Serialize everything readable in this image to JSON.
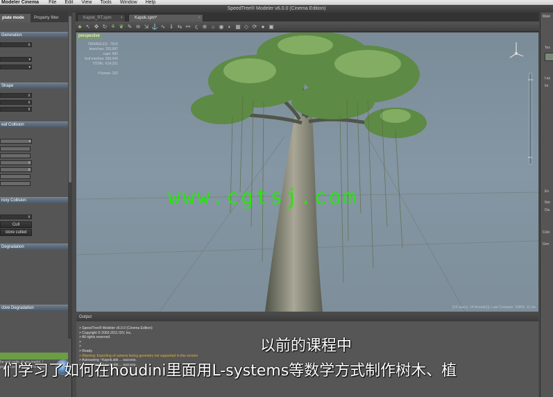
{
  "menubar": {
    "app": "Modeler Cinema",
    "items": [
      "File",
      "Edit",
      "View",
      "Tools",
      "Window",
      "Help"
    ]
  },
  "window": {
    "title": "SpeedTree® Modeler v6.0.0 (Cinema Edition)"
  },
  "left_panel": {
    "tabs": [
      "plate mode",
      "Property filter"
    ],
    "sections": [
      "Generation",
      "Shape",
      "eaf Collision",
      "roxy Collision",
      "Degradation",
      "ctive Degradation"
    ],
    "cull_button": "Cull",
    "restore_button": "store culled",
    "description": "he root node of any model. l parameters such as the t and",
    "colors": {
      "section": "#5c6a79",
      "selected": "#6a9d45"
    }
  },
  "doc_tabs": [
    {
      "label": "Kapok_RT.spm"
    },
    {
      "label": "Kapok.spm*"
    }
  ],
  "viewport": {
    "view_label": "perspective",
    "stats": [
      "TRIANGLES : 7915",
      "branches: 253,687",
      "caps: 582",
      "leaf meshes: 360,042",
      "TOTAL: 614,321"
    ],
    "bones": "# bones: 152",
    "status": "[24 cpu(s), 24 thread(s)], Last Compute: 15865, 11 ms",
    "slider_labels": [
      "Max",
      "Min"
    ],
    "watermark": "www.cgtsj.com"
  },
  "output": {
    "title": "Output",
    "lines": [
      "> SpeedTree® Modeler v6.0.0 (Cinema Edition)",
      "> Copyright © 2003-2011 IDV, Inc.",
      "> All rights reserved.",
      ">",
      ">",
      "> Ready.",
      "> Warning: Exporting of camera facing geometry not supported in this version",
      "> Autosaving ~Kapok.sbk ... success.",
      "> Autosaving ~Kapok.sbk ... success."
    ]
  },
  "right_panel": {
    "items": [
      "Mate",
      "Tex",
      "Lay",
      "Ini",
      "En",
      "Nor",
      "Dis",
      "Colo",
      "Gen"
    ]
  },
  "subtitles": {
    "line1": "以前的课程中",
    "line2": "们学习了如何在houdini里面用L-systems等数学方式制作树木、植"
  }
}
